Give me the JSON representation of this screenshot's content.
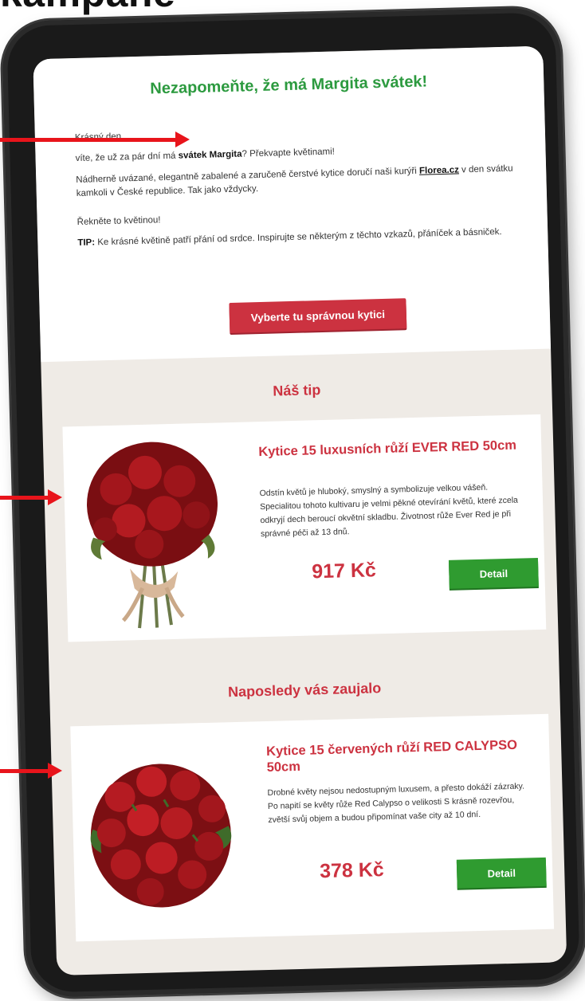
{
  "heading": "kampaně",
  "email": {
    "title": "Nezapomeňte, že má Margita svátek!",
    "greeting": "Krásný den,",
    "line2_pre": "víte, že už za pár dní má ",
    "line2_bold": "svátek Margita",
    "line2_post": "? Překvapte květinami!",
    "para3_pre": "Nádherně uvázané, elegantně zabalené a zaručeně čerstvé kytice doručí naši kurýři ",
    "para3_link": "Florea.cz",
    "para3_post": " v den svátku kamkoli v České republice. Tak jako vždycky.",
    "para4": "Řekněte to květinou!",
    "tip_label": "TIP:",
    "tip_text": " Ke krásné květině patří přání od srdce. Inspirujte se některým z těchto vzkazů, přáníček a básniček.",
    "cta_label": "Vyberte tu správnou kytici"
  },
  "sections": [
    {
      "title": "Náš tip",
      "product": {
        "name": "Kytice 15 luxusních růží EVER RED 50cm",
        "description": "Odstín květů je hluboký, smyslný a symbolizuje velkou vášeň. Specialitou tohoto kultivaru je velmi pěkné otevírání květů, které zcela odkryjí dech beroucí okvětní skladbu. Životnost růže Ever Red je při správné péči až 13 dnů.",
        "price": "917 Kč",
        "button": "Detail"
      }
    },
    {
      "title": "Naposledy vás zaujalo",
      "product": {
        "name": "Kytice 15 červených růží RED CALYPSO 50cm",
        "description": "Drobné květy nejsou nedostupným luxusem, a přesto dokáží zázraky. Po napití se květy růže Red Calypso o velikosti S krásně rozevřou, zvětší svůj objem a budou připomínat vaše city až 10 dní.",
        "price": "378 Kč",
        "button": "Detail"
      }
    }
  ],
  "colors": {
    "green": "#2c9a3f",
    "red": "#cc3240",
    "button_green": "#2f9b30",
    "arrow": "#e8141b"
  }
}
